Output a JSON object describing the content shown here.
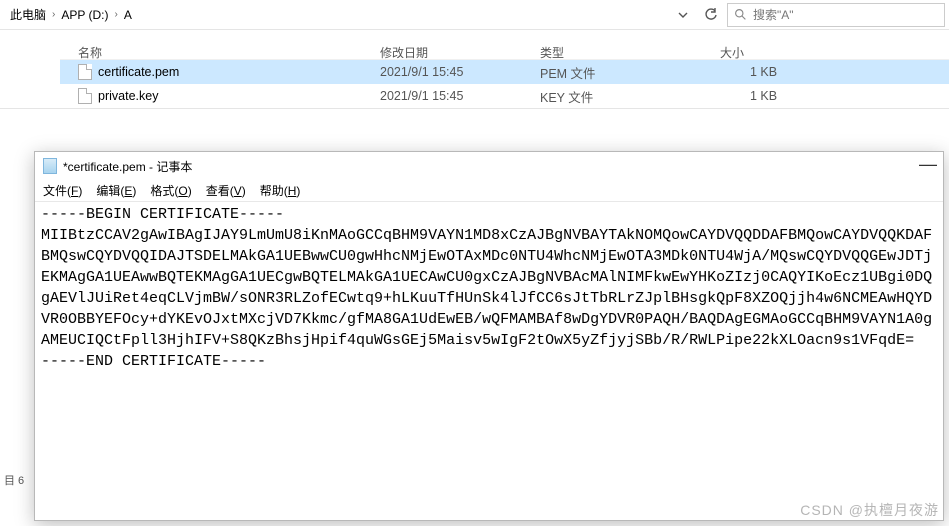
{
  "breadcrumb": {
    "seg1": "此电脑",
    "seg2": "APP (D:)",
    "seg3": "A"
  },
  "search": {
    "placeholder": "搜索\"A\""
  },
  "columns": {
    "name": "名称",
    "date": "修改日期",
    "type": "类型",
    "size": "大小"
  },
  "files": [
    {
      "name": "certificate.pem",
      "date": "2021/9/1 15:45",
      "type": "PEM 文件",
      "size": "1 KB",
      "selected": true
    },
    {
      "name": "private.key",
      "date": "2021/9/1 15:45",
      "type": "KEY 文件",
      "size": "1 KB",
      "selected": false
    }
  ],
  "status_left": "目 6",
  "notepad": {
    "title": "*certificate.pem - 记事本",
    "menu": {
      "file": "文件(<u>F</u>)",
      "edit": "编辑(<u>E</u>)",
      "format": "格式(<u>O</u>)",
      "view": "查看(<u>V</u>)",
      "help": "帮助(<u>H</u>)"
    },
    "minimize": "—",
    "content": "-----BEGIN CERTIFICATE-----\nMIIBtzCCAV2gAwIBAgIJAY9LmUmU8iKnMAoGCCqBHM9VAYN1MD8xCzAJBgNVBAYTAkNOMQowCAYDVQQDDAFBMQowCAYDVQQKDAFBMQswCQYDVQQIDAJTSDELMAkGA1UEBwwCU0gwHhcNMjEwOTAxMDc0NTU4WhcNMjEwOTA3MDk0NTU4WjA/MQswCQYDVQQGEwJDTjEKMAgGA1UEAwwBQTEKMAgGA1UECgwBQTELMAkGA1UECAwCU0gxCzAJBgNVBAcMAlNIMFkwEwYHKoZIzj0CAQYIKoEcz1UBgi0DQgAEVlJUiRet4eqCLVjmBW/sONR3RLZofECwtq9+hLKuuTfHUnSk4lJfCC6sJtTbRLrZJplBHsgkQpF8XZOQjjh4w6NCMEAwHQYDVR0OBBYEFOcy+dYKEvOJxtMXcjVD7Kkmc/gfMA8GA1UdEwEB/wQFMAMBAf8wDgYDVR0PAQH/BAQDAgEGMAoGCCqBHM9VAYN1A0gAMEUCIQCtFpll3HjhIFV+S8QKzBhsjHpif4quWGsGEj5Maisv5wIgF2tOwX5yZfjyjSBb/R/RWLPipe22kXLOacn9s1VFqdE=\n-----END CERTIFICATE-----"
  },
  "watermark": "CSDN @执檀月夜游"
}
